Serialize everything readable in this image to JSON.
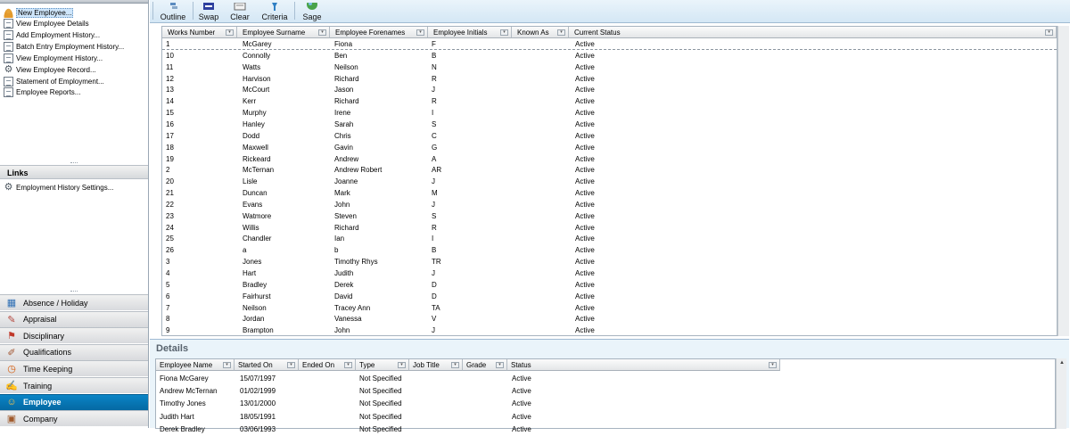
{
  "tasks": [
    {
      "label": "New Employee...",
      "icon": "new-employee-icon",
      "selected": true
    },
    {
      "label": "View Employee Details",
      "icon": "document-icon"
    },
    {
      "label": "Add Employment History...",
      "icon": "document-icon"
    },
    {
      "label": "Batch Entry Employment History...",
      "icon": "document-icon"
    },
    {
      "label": "View Employment History...",
      "icon": "document-icon"
    },
    {
      "label": "View Employee Record...",
      "icon": "gear-icon"
    },
    {
      "label": "Statement of Employment...",
      "icon": "document-icon"
    },
    {
      "label": "Employee Reports...",
      "icon": "document-icon"
    }
  ],
  "links": {
    "title": "Links",
    "items": [
      {
        "label": "Employment History Settings...",
        "icon": "gear-icon"
      }
    ]
  },
  "nav": [
    {
      "label": "Absence / Holiday",
      "icon": "calendar-icon"
    },
    {
      "label": "Appraisal",
      "icon": "appraisal-icon"
    },
    {
      "label": "Disciplinary",
      "icon": "flag-icon"
    },
    {
      "label": "Qualifications",
      "icon": "qualifications-icon"
    },
    {
      "label": "Time Keeping",
      "icon": "clock-icon"
    },
    {
      "label": "Training",
      "icon": "training-icon"
    },
    {
      "label": "Employee",
      "icon": "employee-icon",
      "active": true
    },
    {
      "label": "Company",
      "icon": "company-icon"
    }
  ],
  "toolbar": {
    "buttons": [
      {
        "label": "Outline",
        "icon": "outline-icon"
      },
      {
        "label": "Swap",
        "icon": "swap-icon"
      },
      {
        "label": "Clear",
        "icon": "clear-icon"
      },
      {
        "label": "Criteria",
        "icon": "criteria-icon"
      },
      {
        "label": "Sage",
        "icon": "sage-globe-icon"
      }
    ]
  },
  "grid": {
    "columns": [
      "Works Number",
      "Employee Surname",
      "Employee Forenames",
      "Employee Initials",
      "Known As",
      "Current Status"
    ],
    "rows": [
      [
        "1",
        "McGarey",
        "Fiona",
        "F",
        "",
        "Active"
      ],
      [
        "10",
        "Connolly",
        "Ben",
        "B",
        "",
        "Active"
      ],
      [
        "11",
        "Watts",
        "Neilson",
        "N",
        "",
        "Active"
      ],
      [
        "12",
        "Harvison",
        "Richard",
        "R",
        "",
        "Active"
      ],
      [
        "13",
        "McCourt",
        "Jason",
        "J",
        "",
        "Active"
      ],
      [
        "14",
        "Kerr",
        "Richard",
        "R",
        "",
        "Active"
      ],
      [
        "15",
        "Murphy",
        "Irene",
        "I",
        "",
        "Active"
      ],
      [
        "16",
        "Hanley",
        "Sarah",
        "S",
        "",
        "Active"
      ],
      [
        "17",
        "Dodd",
        "Chris",
        "C",
        "",
        "Active"
      ],
      [
        "18",
        "Maxwell",
        "Gavin",
        "G",
        "",
        "Active"
      ],
      [
        "19",
        "Rickeard",
        "Andrew",
        "A",
        "",
        "Active"
      ],
      [
        "2",
        "McTernan",
        "Andrew Robert",
        "AR",
        "",
        "Active"
      ],
      [
        "20",
        "Lisle",
        "Joanne",
        "J",
        "",
        "Active"
      ],
      [
        "21",
        "Duncan",
        "Mark",
        "M",
        "",
        "Active"
      ],
      [
        "22",
        "Evans",
        "John",
        "J",
        "",
        "Active"
      ],
      [
        "23",
        "Watmore",
        "Steven",
        "S",
        "",
        "Active"
      ],
      [
        "24",
        "Willis",
        "Richard",
        "R",
        "",
        "Active"
      ],
      [
        "25",
        "Chandler",
        "Ian",
        "I",
        "",
        "Active"
      ],
      [
        "26",
        "a",
        "b",
        "B",
        "",
        "Active"
      ],
      [
        "3",
        "Jones",
        "Timothy Rhys",
        "TR",
        "",
        "Active"
      ],
      [
        "4",
        "Hart",
        "Judith",
        "J",
        "",
        "Active"
      ],
      [
        "5",
        "Bradley",
        "Derek",
        "D",
        "",
        "Active"
      ],
      [
        "6",
        "Fairhurst",
        "David",
        "D",
        "",
        "Active"
      ],
      [
        "7",
        "Neilson",
        "Tracey Ann",
        "TA",
        "",
        "Active"
      ],
      [
        "8",
        "Jordan",
        "Vanessa",
        "V",
        "",
        "Active"
      ],
      [
        "9",
        "Brampton",
        "John",
        "J",
        "",
        "Active"
      ]
    ]
  },
  "details": {
    "title": "Details",
    "columns": [
      "Employee Name",
      "Started On",
      "Ended On",
      "Type",
      "Job Title",
      "Grade",
      "Status"
    ],
    "rows": [
      [
        "Fiona McGarey",
        "15/07/1997",
        "",
        "Not Specified",
        "",
        "",
        "Active"
      ],
      [
        "Andrew McTernan",
        "01/02/1999",
        "",
        "Not Specified",
        "",
        "",
        "Active"
      ],
      [
        "Timothy Jones",
        "13/01/2000",
        "",
        "Not Specified",
        "",
        "",
        "Active"
      ],
      [
        "Judith Hart",
        "18/05/1991",
        "",
        "Not Specified",
        "",
        "",
        "Active"
      ],
      [
        "Derek Bradley",
        "03/06/1993",
        "",
        "Not Specified",
        "",
        "",
        "Active"
      ]
    ]
  }
}
